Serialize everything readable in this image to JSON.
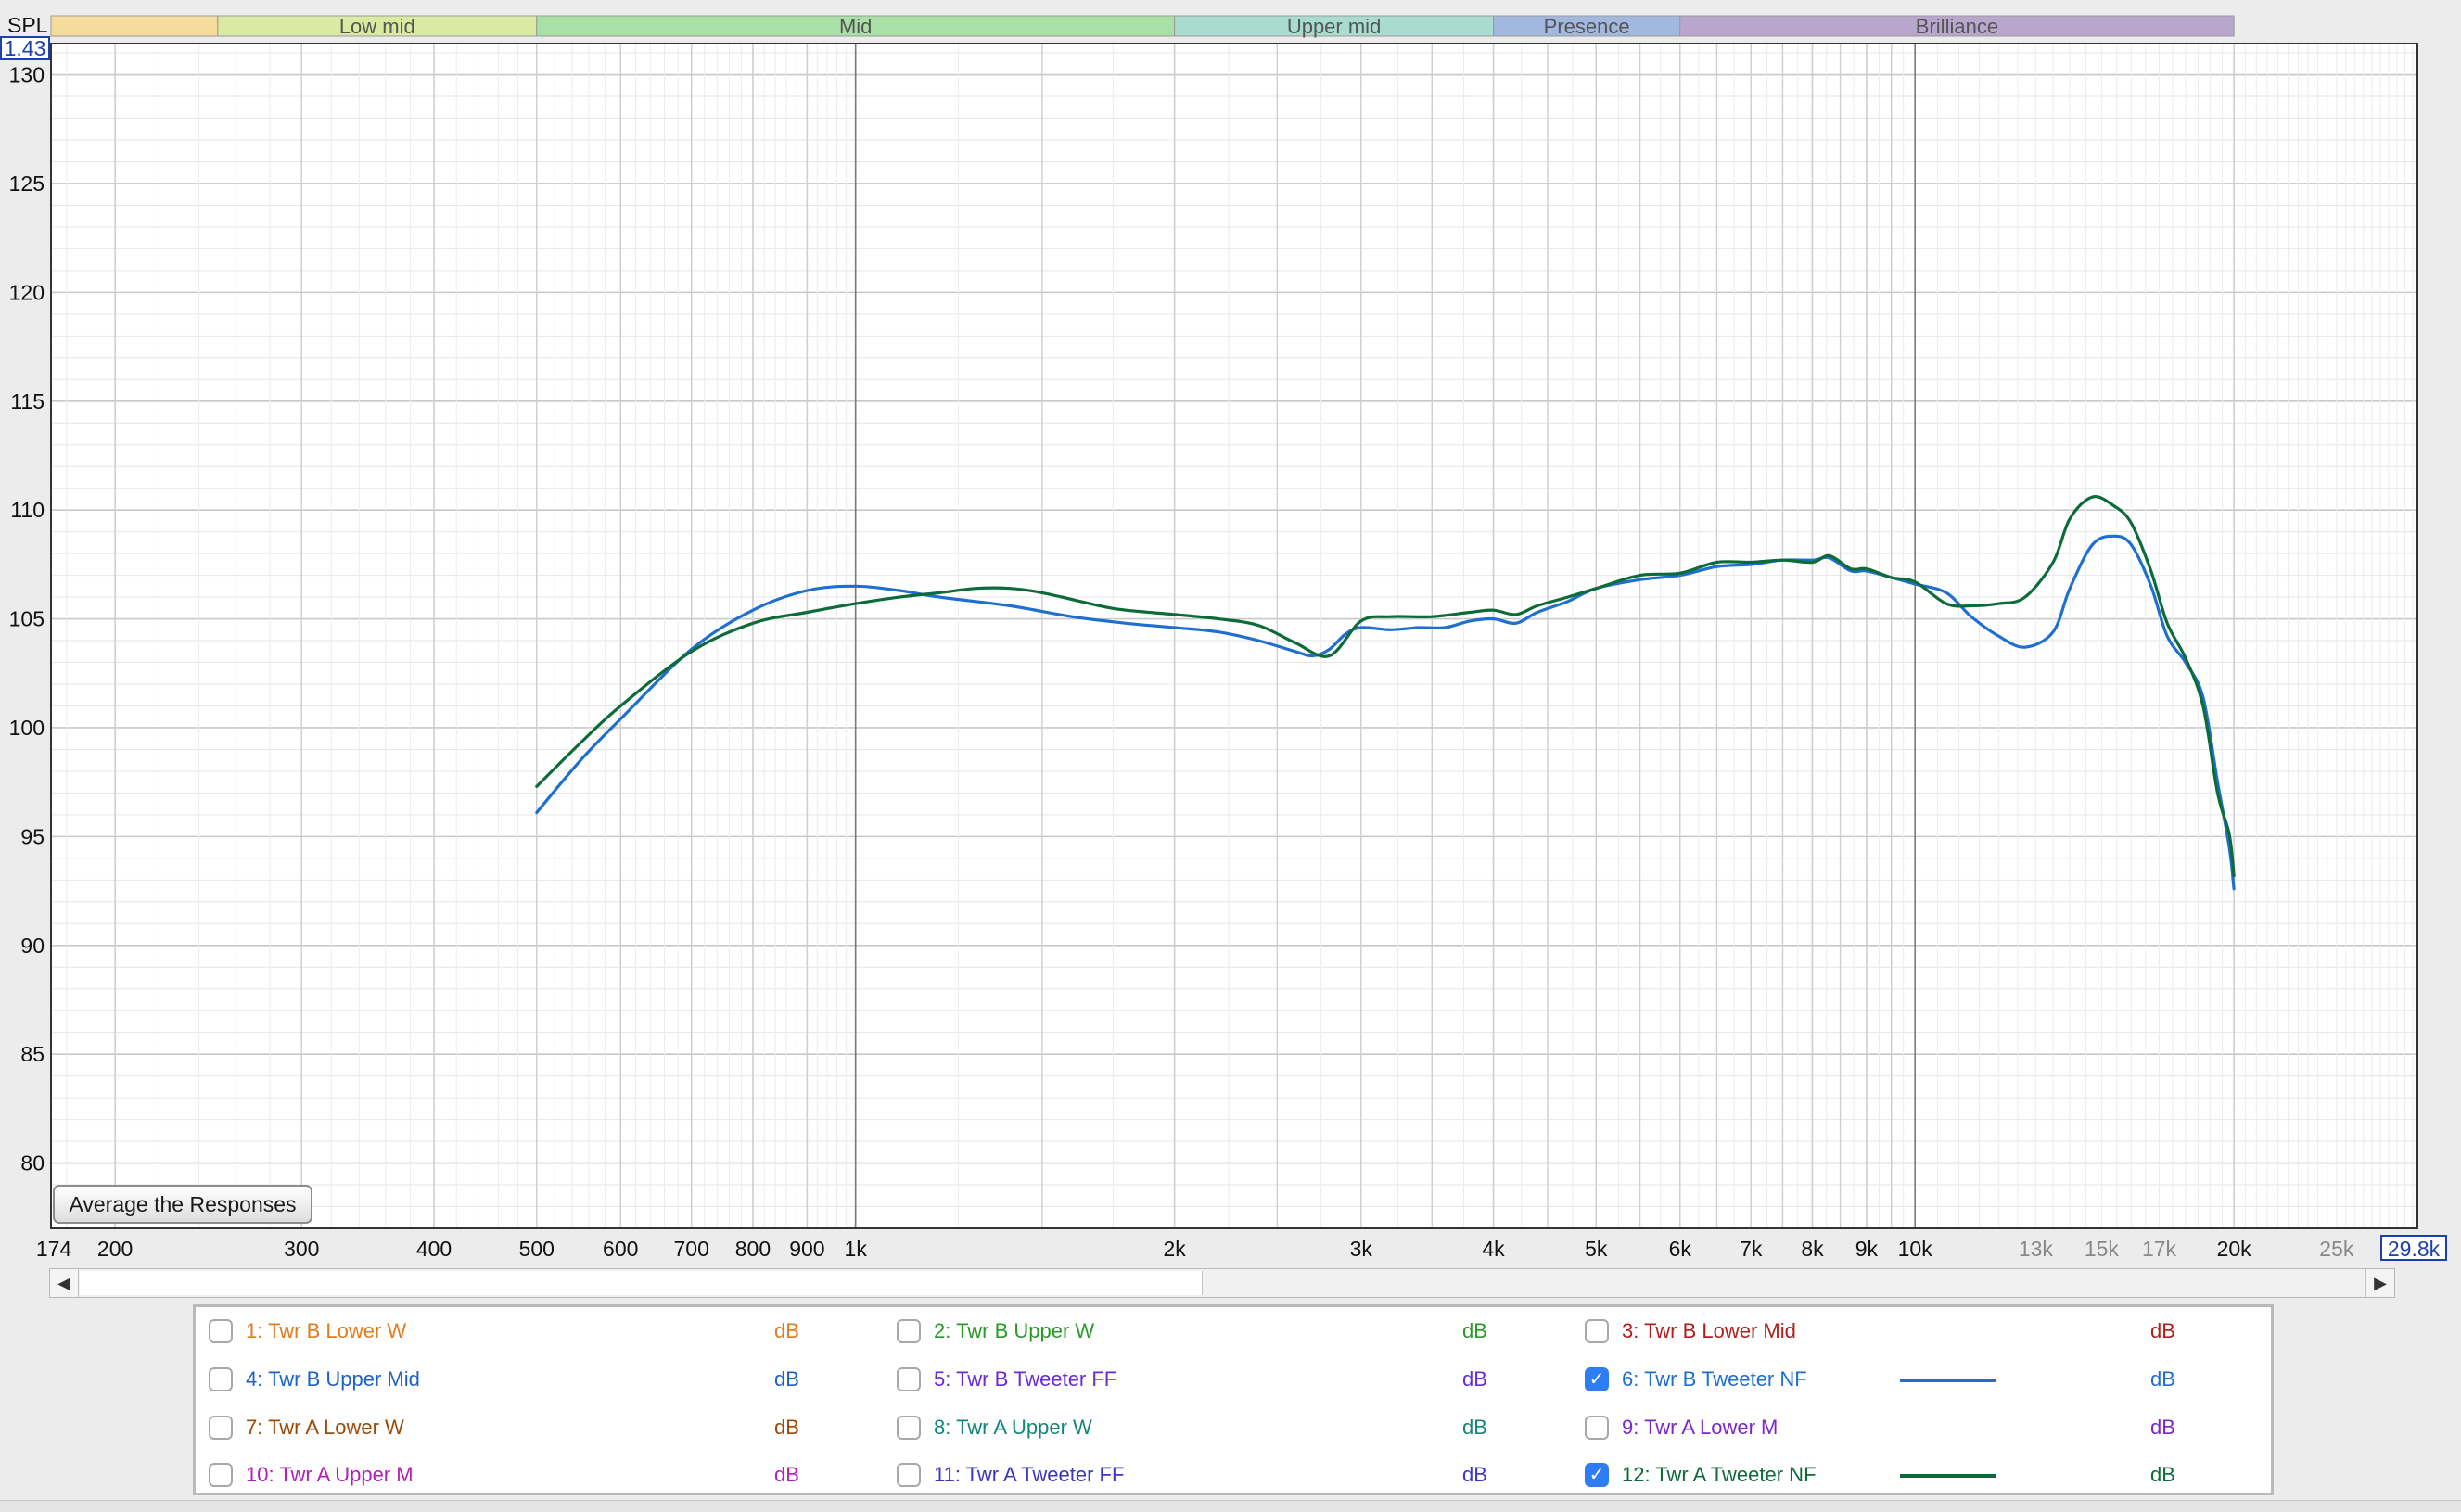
{
  "axis": {
    "spl_label": "SPL",
    "y_readout": "1.43",
    "x_readout": "29.8k",
    "x_start_label": "174",
    "y_ticks": [
      "130",
      "125",
      "120",
      "115",
      "110",
      "105",
      "100",
      "95",
      "90",
      "85",
      "80"
    ],
    "x_ticks": [
      {
        "f": 200,
        "label": "200",
        "major": false
      },
      {
        "f": 300,
        "label": "300",
        "major": false
      },
      {
        "f": 400,
        "label": "400",
        "major": false
      },
      {
        "f": 500,
        "label": "500",
        "major": false
      },
      {
        "f": 600,
        "label": "600",
        "major": false
      },
      {
        "f": 700,
        "label": "700",
        "major": false
      },
      {
        "f": 800,
        "label": "800",
        "major": false
      },
      {
        "f": 900,
        "label": "900",
        "major": false
      },
      {
        "f": 1000,
        "label": "1k",
        "major": true
      },
      {
        "f": 2000,
        "label": "2k",
        "major": false
      },
      {
        "f": 3000,
        "label": "3k",
        "major": false
      },
      {
        "f": 4000,
        "label": "4k",
        "major": false
      },
      {
        "f": 5000,
        "label": "5k",
        "major": false
      },
      {
        "f": 6000,
        "label": "6k",
        "major": false
      },
      {
        "f": 7000,
        "label": "7k",
        "major": false
      },
      {
        "f": 8000,
        "label": "8k",
        "major": false
      },
      {
        "f": 9000,
        "label": "9k",
        "major": false
      },
      {
        "f": 10000,
        "label": "10k",
        "major": true
      },
      {
        "f": 13000,
        "label": "13k",
        "major": false,
        "dim": true
      },
      {
        "f": 15000,
        "label": "15k",
        "major": false,
        "dim": true
      },
      {
        "f": 17000,
        "label": "17k",
        "major": false,
        "dim": true
      },
      {
        "f": 20000,
        "label": "20k",
        "major": false
      },
      {
        "f": 25000,
        "label": "25k",
        "major": false,
        "dim": true
      }
    ]
  },
  "bands": [
    {
      "label": "",
      "from": 174,
      "to": 250,
      "color": "#f6dc9c"
    },
    {
      "label": "Low mid",
      "from": 250,
      "to": 500,
      "color": "#dbeaa2"
    },
    {
      "label": "Mid",
      "from": 500,
      "to": 2000,
      "color": "#a9e0a6"
    },
    {
      "label": "Upper mid",
      "from": 2000,
      "to": 4000,
      "color": "#a7dccf"
    },
    {
      "label": "Presence",
      "from": 4000,
      "to": 6000,
      "color": "#a3b8de"
    },
    {
      "label": "Brilliance",
      "from": 6000,
      "to": 20000,
      "color": "#b9a6cc"
    }
  ],
  "average_button": "Average the Responses",
  "chart_data": {
    "type": "line",
    "xscale": "log",
    "xlim": [
      174,
      29800
    ],
    "ylim": [
      77,
      131.43
    ],
    "series": [
      {
        "name": "6: Twr B Tweeter NF",
        "color": "#1e6fd0",
        "points": [
          [
            500,
            96.1
          ],
          [
            550,
            98.5
          ],
          [
            600,
            100.4
          ],
          [
            700,
            103.6
          ],
          [
            800,
            105.4
          ],
          [
            900,
            106.3
          ],
          [
            1000,
            106.5
          ],
          [
            1100,
            106.3
          ],
          [
            1200,
            106.0
          ],
          [
            1400,
            105.6
          ],
          [
            1600,
            105.1
          ],
          [
            1800,
            104.8
          ],
          [
            2000,
            104.6
          ],
          [
            2200,
            104.4
          ],
          [
            2400,
            104.0
          ],
          [
            2600,
            103.5
          ],
          [
            2700,
            103.3
          ],
          [
            2800,
            103.6
          ],
          [
            2900,
            104.3
          ],
          [
            3000,
            104.6
          ],
          [
            3200,
            104.5
          ],
          [
            3400,
            104.6
          ],
          [
            3600,
            104.6
          ],
          [
            3800,
            104.9
          ],
          [
            4000,
            105.0
          ],
          [
            4200,
            104.8
          ],
          [
            4400,
            105.3
          ],
          [
            4700,
            105.8
          ],
          [
            5000,
            106.4
          ],
          [
            5500,
            106.8
          ],
          [
            6000,
            107.0
          ],
          [
            6500,
            107.4
          ],
          [
            7000,
            107.5
          ],
          [
            7500,
            107.7
          ],
          [
            8000,
            107.7
          ],
          [
            8300,
            107.8
          ],
          [
            8700,
            107.2
          ],
          [
            9000,
            107.2
          ],
          [
            9500,
            106.9
          ],
          [
            10000,
            106.6
          ],
          [
            10700,
            106.2
          ],
          [
            11300,
            105.1
          ],
          [
            12000,
            104.2
          ],
          [
            12700,
            103.7
          ],
          [
            13500,
            104.4
          ],
          [
            14000,
            106.4
          ],
          [
            14700,
            108.4
          ],
          [
            15400,
            108.8
          ],
          [
            16000,
            108.4
          ],
          [
            16700,
            106.5
          ],
          [
            17300,
            104.2
          ],
          [
            18000,
            103.0
          ],
          [
            18700,
            101.4
          ],
          [
            19300,
            97.5
          ],
          [
            19800,
            94.5
          ],
          [
            20000,
            92.6
          ]
        ]
      },
      {
        "name": "12: Twr A Tweeter NF",
        "color": "#0d6b3a",
        "points": [
          [
            500,
            97.3
          ],
          [
            550,
            99.3
          ],
          [
            600,
            101.0
          ],
          [
            700,
            103.5
          ],
          [
            800,
            104.8
          ],
          [
            900,
            105.3
          ],
          [
            1000,
            105.7
          ],
          [
            1100,
            106.0
          ],
          [
            1200,
            106.2
          ],
          [
            1300,
            106.4
          ],
          [
            1400,
            106.4
          ],
          [
            1500,
            106.2
          ],
          [
            1700,
            105.6
          ],
          [
            1800,
            105.4
          ],
          [
            2000,
            105.2
          ],
          [
            2200,
            105.0
          ],
          [
            2400,
            104.7
          ],
          [
            2600,
            103.9
          ],
          [
            2800,
            103.3
          ],
          [
            3000,
            104.9
          ],
          [
            3200,
            105.1
          ],
          [
            3500,
            105.1
          ],
          [
            3800,
            105.3
          ],
          [
            4000,
            105.4
          ],
          [
            4200,
            105.2
          ],
          [
            4400,
            105.6
          ],
          [
            4700,
            106.0
          ],
          [
            5000,
            106.4
          ],
          [
            5500,
            107.0
          ],
          [
            6000,
            107.1
          ],
          [
            6500,
            107.6
          ],
          [
            7000,
            107.6
          ],
          [
            7500,
            107.7
          ],
          [
            8000,
            107.6
          ],
          [
            8300,
            107.9
          ],
          [
            8700,
            107.3
          ],
          [
            9000,
            107.3
          ],
          [
            9500,
            106.9
          ],
          [
            10000,
            106.7
          ],
          [
            10700,
            105.7
          ],
          [
            11300,
            105.6
          ],
          [
            12000,
            105.7
          ],
          [
            12700,
            106.0
          ],
          [
            13500,
            107.6
          ],
          [
            14000,
            109.6
          ],
          [
            14700,
            110.6
          ],
          [
            15400,
            110.2
          ],
          [
            16000,
            109.4
          ],
          [
            16700,
            107.2
          ],
          [
            17300,
            104.8
          ],
          [
            18000,
            103.2
          ],
          [
            18700,
            101.0
          ],
          [
            19300,
            97.0
          ],
          [
            19800,
            95.1
          ],
          [
            20000,
            93.2
          ]
        ]
      }
    ]
  },
  "legend": [
    {
      "name": "1: Twr B Lower W",
      "unit": "dB",
      "color": "#e07b1e",
      "checked": false,
      "swatch": false
    },
    {
      "name": "2: Twr B Upper W",
      "unit": "dB",
      "color": "#2a9a2a",
      "checked": false,
      "swatch": false
    },
    {
      "name": "3: Twr B Lower Mid",
      "unit": "dB",
      "color": "#b01e1e",
      "checked": false,
      "swatch": false
    },
    {
      "name": "4: Twr B Upper Mid",
      "unit": "dB",
      "color": "#1e62c8",
      "checked": false,
      "swatch": false
    },
    {
      "name": "5: Twr B Tweeter FF",
      "unit": "dB",
      "color": "#6a2bd6",
      "checked": false,
      "swatch": false
    },
    {
      "name": "6: Twr B Tweeter NF",
      "unit": "dB",
      "color": "#1e6fd0",
      "checked": true,
      "swatch": true
    },
    {
      "name": "7: Twr A Lower W",
      "unit": "dB",
      "color": "#9c4a08",
      "checked": false,
      "swatch": false
    },
    {
      "name": "8: Twr A Upper W",
      "unit": "dB",
      "color": "#14857a",
      "checked": false,
      "swatch": false
    },
    {
      "name": "9: Twr A Lower M",
      "unit": "dB",
      "color": "#7a28c8",
      "checked": false,
      "swatch": false
    },
    {
      "name": "10: Twr A Upper M",
      "unit": "dB",
      "color": "#b21fb8",
      "checked": false,
      "swatch": false
    },
    {
      "name": "11: Twr A Tweeter FF",
      "unit": "dB",
      "color": "#3d36c2",
      "checked": false,
      "swatch": false
    },
    {
      "name": "12: Twr A Tweeter NF",
      "unit": "dB",
      "color": "#0d6b3a",
      "checked": true,
      "swatch": true
    }
  ]
}
